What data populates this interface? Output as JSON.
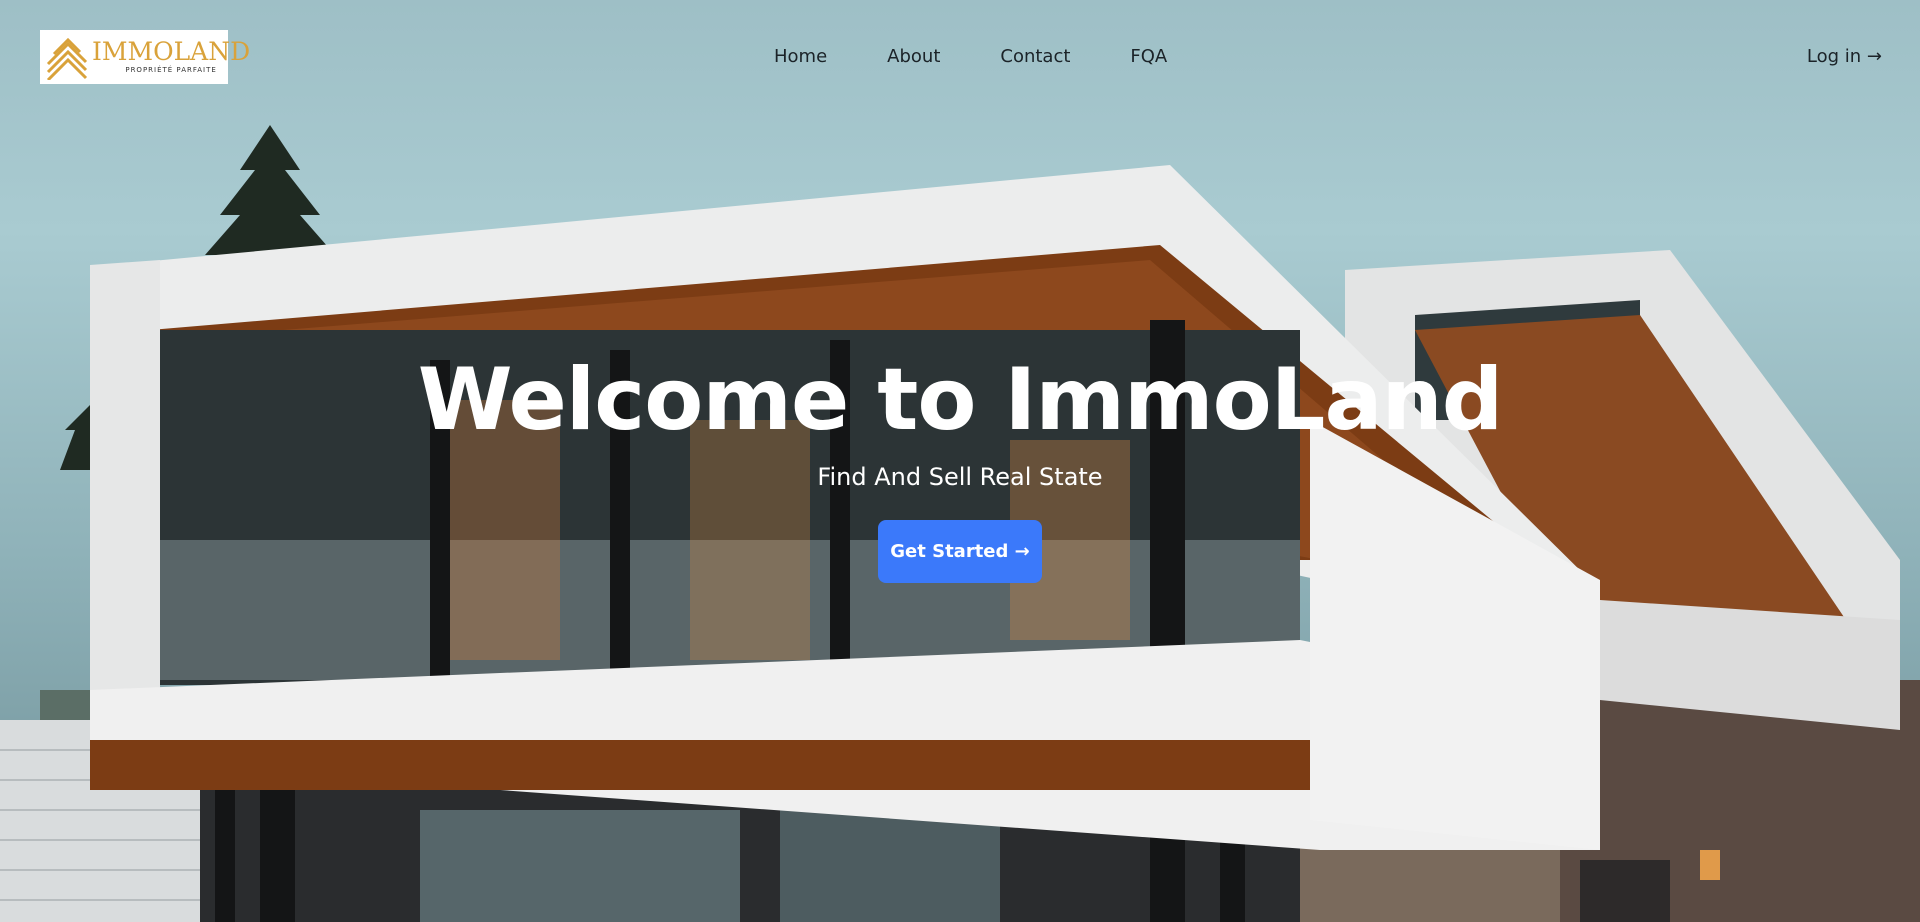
{
  "brand": {
    "name": "IMMOLAND",
    "tagline": "PROPRIÉTÉ PARFAITE",
    "color": "#d9a23a"
  },
  "nav": {
    "items": [
      {
        "label": "Home"
      },
      {
        "label": "About"
      },
      {
        "label": "Contact"
      },
      {
        "label": "FQA"
      }
    ],
    "login_label": "Log in →"
  },
  "hero": {
    "title": "Welcome to ImmoLand",
    "subtitle": "Find And Sell Real State",
    "cta_label": "Get Started →",
    "cta_color": "#3b79fa",
    "background_image": "modern-house-photo"
  }
}
